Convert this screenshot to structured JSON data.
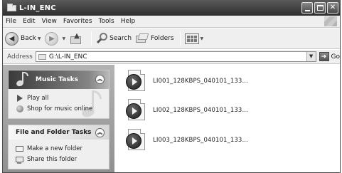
{
  "window": {
    "title": "L-IN_ENC"
  },
  "menu": {
    "items": [
      "File",
      "Edit",
      "View",
      "Favorites",
      "Tools",
      "Help"
    ]
  },
  "toolbar": {
    "back_label": "Back",
    "search_label": "Search",
    "folders_label": "Folders"
  },
  "address": {
    "label": "Address",
    "value": "G:\\L-IN_ENC",
    "go_label": "Go"
  },
  "music_tasks": {
    "title": "Music Tasks",
    "items": [
      "Play all",
      "Shop for music online"
    ]
  },
  "file_folder_tasks": {
    "title": "File and Folder Tasks",
    "items": [
      "Make a new folder",
      "Share this folder"
    ]
  },
  "files": [
    {
      "name": "LI001_128KBPS_040101_133..."
    },
    {
      "name": "LI002_128KBPS_040101_133..."
    },
    {
      "name": "LI003_128KBPS_040101_133..."
    }
  ]
}
